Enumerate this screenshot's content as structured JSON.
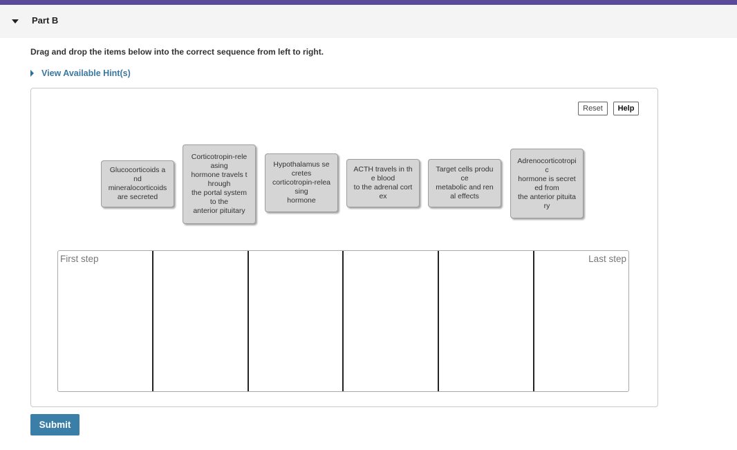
{
  "part": {
    "title": "Part B"
  },
  "instructions": "Drag and drop the items below into the correct sequence from left to right.",
  "hint": {
    "label": "View Available Hint(s)"
  },
  "toolbar": {
    "reset_label": "Reset",
    "help_label": "Help"
  },
  "items": [
    {
      "text": "Glucocorticoids a\nnd\nmineralocorticoids\nare secreted"
    },
    {
      "text": "Corticotropin-rele\nasing\nhormone travels t\nhrough\nthe portal system\nto the\nanterior pituitary"
    },
    {
      "text": "Hypothalamus se\ncretes\ncorticotropin-relea\nsing\nhormone"
    },
    {
      "text": "ACTH travels in th\ne blood\nto the adrenal cort\nex"
    },
    {
      "text": "Target cells produ\nce\nmetabolic and ren\nal effects"
    },
    {
      "text": "Adrenocorticotropi\nc\nhormone is secret\ned from\nthe anterior pituita\nry"
    }
  ],
  "sequence": {
    "first_label": "First step",
    "last_label": "Last step",
    "slot_count": 6
  },
  "submit_label": "Submit",
  "colors": {
    "accent_stripe": "#5b4a9b",
    "submit_bg": "#3b7ea8",
    "hint_link": "#3a77a1",
    "tile_bg": "#d5d5d5"
  }
}
